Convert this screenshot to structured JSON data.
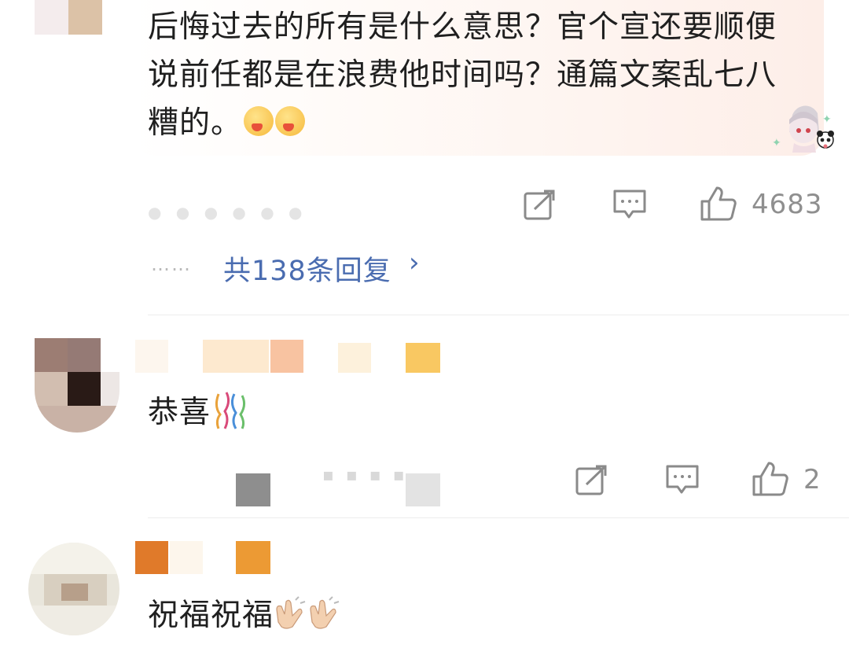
{
  "comments": [
    {
      "text": "后悔过去的所有是什么意思？官个宣还要顺便说前任都是在浪费他时间吗？通篇文案乱七八糟的。",
      "emojis": [
        "face-savoring-food-emoji",
        "face-savoring-food-emoji"
      ],
      "likes": "4683",
      "reply_summary": "共138条回复",
      "reply_dots": "……",
      "reply_chevron": "›"
    },
    {
      "text": "恭喜",
      "emoji": "confetti-ball-emoji",
      "likes": "2"
    },
    {
      "text": "祝福祝福",
      "emoji": "clapping-hands-emoji"
    }
  ],
  "colors": {
    "link": "#4a6cb0",
    "action_icon": "#8a8a8a",
    "text": "#1f1f1f"
  }
}
